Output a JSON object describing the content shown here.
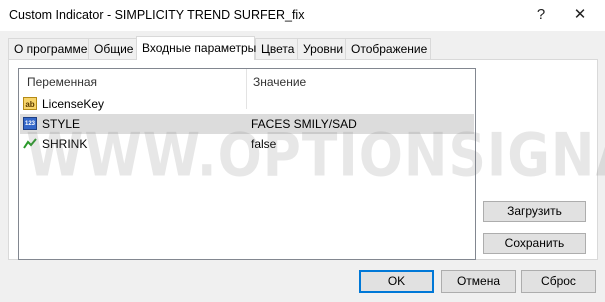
{
  "window": {
    "title": "Custom Indicator - SIMPLICITY TREND SURFER_fix",
    "help": "?",
    "close": "✕"
  },
  "tabs": [
    "О программе",
    "Общие",
    "Входные параметры",
    "Цвета",
    "Уровни",
    "Отображение"
  ],
  "table": {
    "headers": [
      "Переменная",
      "Значение"
    ],
    "rows": [
      {
        "icon": "string-icon",
        "badge": "ab",
        "name": "LicenseKey",
        "value": ""
      },
      {
        "icon": "integer-icon",
        "badge": "123",
        "name": "STYLE",
        "value": "FACES SMILY/SAD"
      },
      {
        "icon": "boolean-icon",
        "badge": "",
        "name": "SHRINK",
        "value": "false"
      }
    ]
  },
  "side_buttons": {
    "load": "Загрузить",
    "save": "Сохранить"
  },
  "footer": {
    "ok": "OK",
    "cancel": "Отмена",
    "reset": "Сброс"
  },
  "watermark": "WWW.OPTIONSIGNALS.COM",
  "colors": {
    "selection": "#dcdcdc",
    "default_button_border": "#0078d7",
    "string_icon": "#f7d46a",
    "integer_icon": "#3568c9",
    "boolean_icon": "#2a9a2a"
  }
}
